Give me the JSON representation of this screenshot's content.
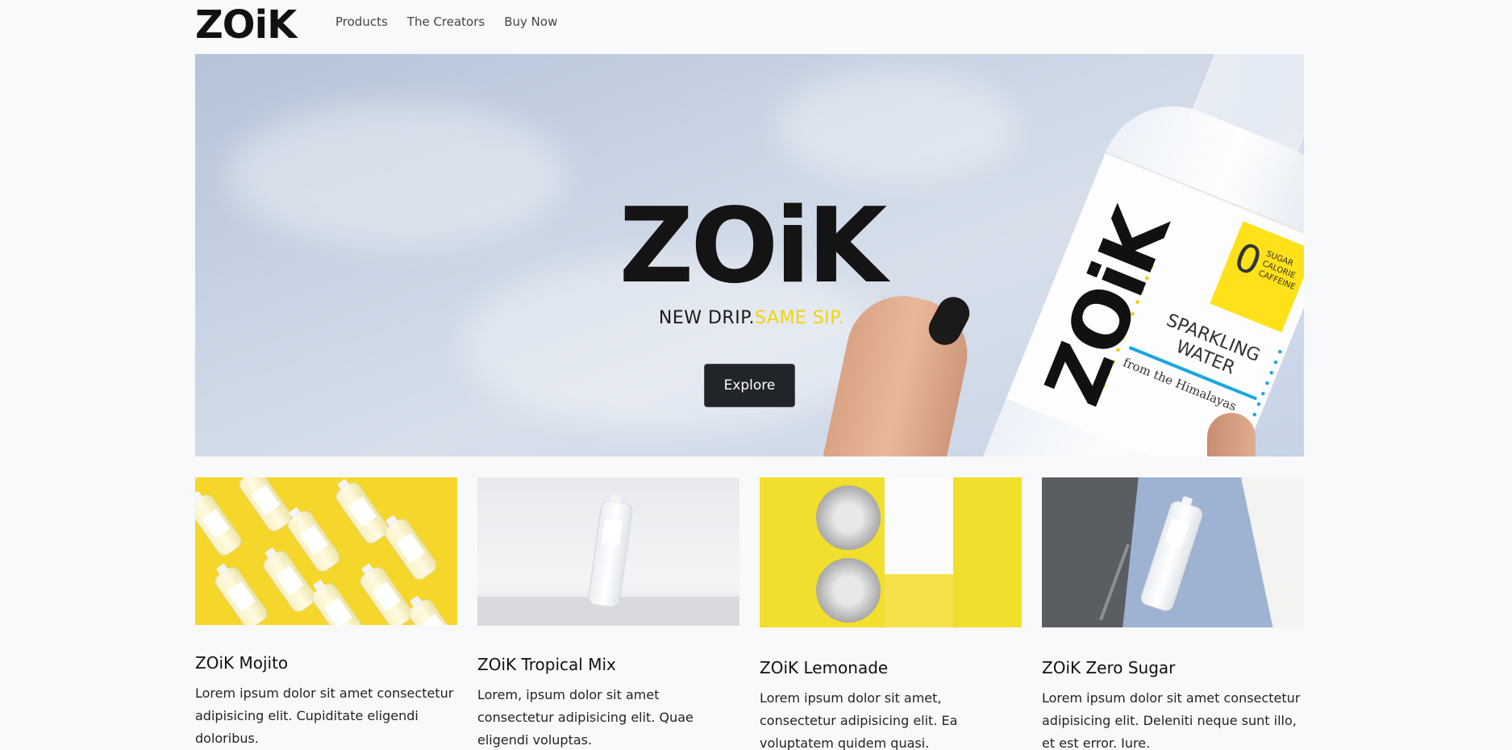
{
  "brand": {
    "name": "ZOiK",
    "dot_color": "#f2d600"
  },
  "nav": {
    "items": [
      "Products",
      "The Creators",
      "Buy Now"
    ]
  },
  "hero": {
    "logo": "ZOiK",
    "tagline_part1": "NEW DRIP.",
    "tagline_part2": "SAME SIP.",
    "button_label": "Explore",
    "bottle_label": {
      "brand": "ZOiK",
      "zero": "0",
      "sticker": [
        "SUGAR",
        "CALORIE",
        "CAFFEINE"
      ],
      "product": [
        "SPARKLING",
        "WATER"
      ],
      "origin": "from the Himalayas"
    }
  },
  "cards": [
    {
      "title": "ZOiK Mojito",
      "text": "Lorem ipsum dolor sit amet consectetur adipisicing elit. Cupiditate eligendi doloribus."
    },
    {
      "title": "ZOiK Tropical Mix",
      "text": "Lorem, ipsum dolor sit amet consectetur adipisicing elit. Quae eligendi voluptas."
    },
    {
      "title": "ZOiK Lemonade",
      "text": "Lorem ipsum dolor sit amet, consectetur adipisicing elit. Ea voluptatem quidem quasi."
    },
    {
      "title": "ZOiK Zero Sugar",
      "text": "Lorem ipsum dolor sit amet consectetur adipisicing elit. Deleniti neque sunt illo, et est error. Iure."
    }
  ],
  "colors": {
    "accent": "#f2d600",
    "button_bg": "#212529",
    "page_bg": "#f8f9fa"
  }
}
